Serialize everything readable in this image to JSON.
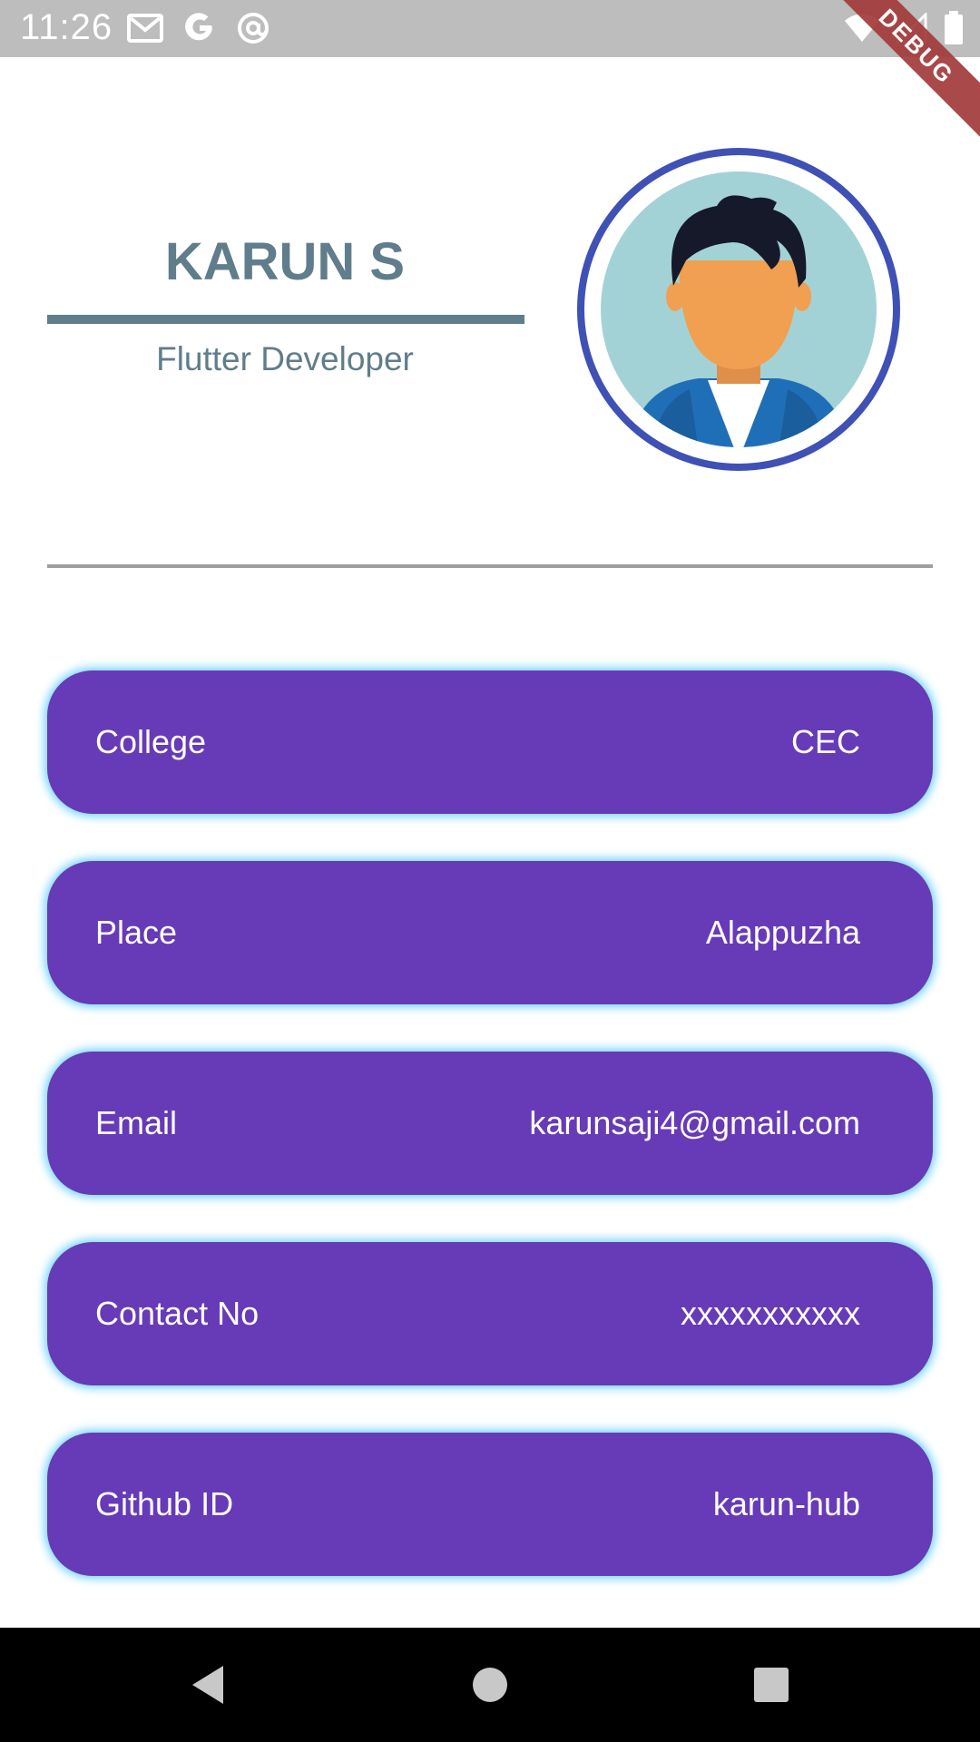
{
  "status_bar": {
    "time": "11:26",
    "left_icons": [
      "gmail-icon",
      "google-icon",
      "at-sign-icon"
    ],
    "right_icons": [
      "wifi-icon",
      "cell-signal-icon",
      "battery-icon"
    ]
  },
  "debug_banner": "DEBUG",
  "profile": {
    "name": "KARUN S",
    "role": "Flutter Developer",
    "avatar_icon": "avatar-person-icon"
  },
  "info_cards": [
    {
      "label": "College",
      "value": "CEC"
    },
    {
      "label": "Place",
      "value": "Alappuzha"
    },
    {
      "label": "Email",
      "value": "karunsaji4@gmail.com"
    },
    {
      "label": "Contact No",
      "value": "xxxxxxxxxxx"
    },
    {
      "label": "Github ID",
      "value": "karun-hub"
    }
  ],
  "nav_bar": {
    "buttons": [
      "back-icon",
      "home-icon",
      "recents-icon"
    ]
  },
  "colors": {
    "card_background": "#673ab7",
    "card_glow": "#40c4ff",
    "name_color": "#607d8b",
    "avatar_ring": "#3f51b5",
    "status_bar": "#bdbdbd",
    "nav_bar": "#000000"
  }
}
